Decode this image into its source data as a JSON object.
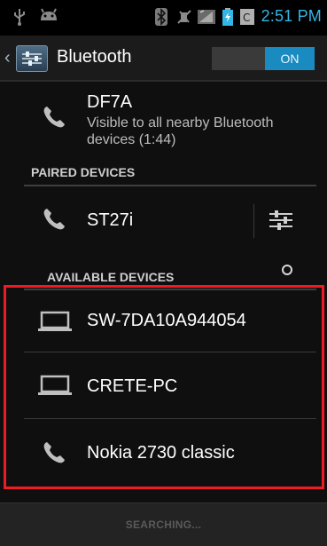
{
  "status_bar": {
    "time": "2:51 PM",
    "icons": [
      "usb-icon",
      "android-icon",
      "bluetooth-icon",
      "vibrate-icon",
      "signal-icon",
      "battery-icon",
      "clock-widget-icon"
    ]
  },
  "action_bar": {
    "title": "Bluetooth",
    "toggle_label": "ON"
  },
  "this_device": {
    "name": "DF7A",
    "subtitle": "Visible to all nearby Bluetooth devices (1:44)"
  },
  "sections": {
    "paired_header": "PAIRED DEVICES",
    "available_header": "AVAILABLE DEVICES"
  },
  "paired_devices": [
    {
      "name": "ST27i",
      "icon": "phone-icon"
    }
  ],
  "available_devices": [
    {
      "name": "SW-7DA10A944054",
      "icon": "laptop-icon"
    },
    {
      "name": "CRETE-PC",
      "icon": "laptop-icon"
    },
    {
      "name": "Nokia 2730 classic",
      "icon": "phone-icon"
    }
  ],
  "footer": {
    "status": "SEARCHING..."
  },
  "colors": {
    "accent": "#33b5e5",
    "toggle_on": "#1a8bc1",
    "highlight": "#ee1b24"
  }
}
